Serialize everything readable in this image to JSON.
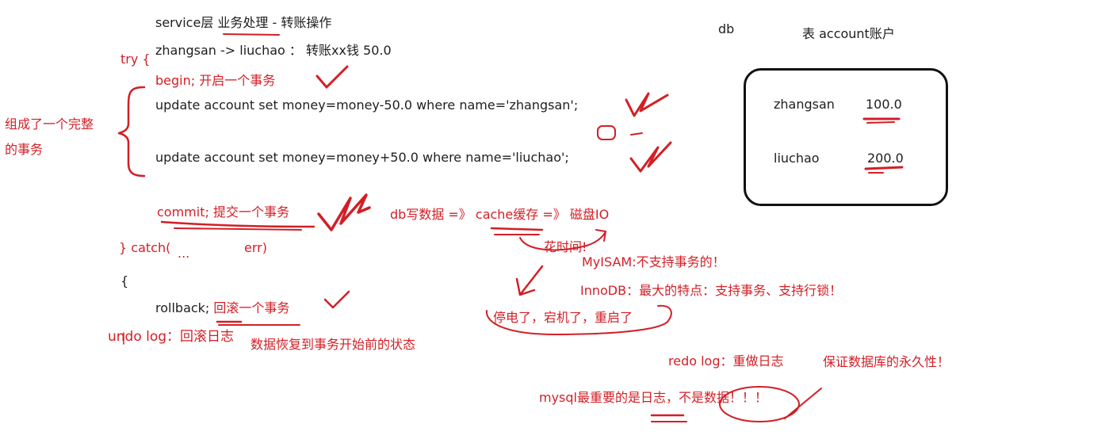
{
  "code": {
    "title": "service层 业务处理 - 转账操作",
    "transfer_desc": "zhangsan -> liuchao ： 转账xx钱   50.0",
    "try_open": "try {",
    "begin": "begin;  开启一个事务",
    "update1": "update account set money=money-50.0 where name='zhangsan';",
    "update2": "update account set money=money+50.0 where name='liuchao';",
    "commit": "commit;  提交一个事务",
    "catch_line": "} catch(",
    "catch_dots": "...",
    "catch_err": "err)",
    "catch_brace": "{",
    "rollback_prefix": "rollback; ",
    "rollback_note": "回滚一个事务",
    "undo_log": "undo log：回滚日志",
    "undo_desc": "数据恢复到事务开始前的状态"
  },
  "annotations": {
    "complete_tx_line1": "组成了一个完整",
    "complete_tx_line2": "的事务",
    "db_write": "db写数据 =》 cache缓存 =》 磁盘IO",
    "takes_time": "花时间!",
    "myisam": "MyISAM:不支持事务的！",
    "innodb": "InnoDB：最大的特点：支持事务、支持行锁！",
    "power_outage": "停电了，宕机了，重启了",
    "redo_log": "redo log：重做日志",
    "durability": "保证数据库的永久性！",
    "log_importance": "mysql最重要的是日志，不是数据！！！"
  },
  "db": {
    "label": "db",
    "table_title": "表 account账户",
    "rows": [
      {
        "name": "zhangsan",
        "money": "100.0"
      },
      {
        "name": "liuchao",
        "money": "200.0"
      }
    ]
  },
  "colors": {
    "ink": "#d21f26",
    "text": "#1e1e1e",
    "box_border": "#111111"
  }
}
